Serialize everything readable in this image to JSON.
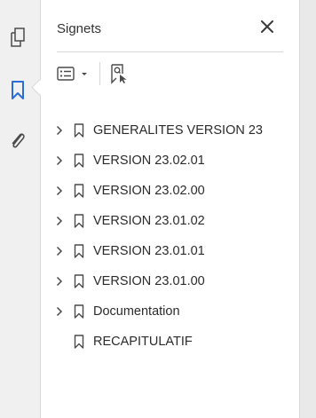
{
  "colors": {
    "accent": "#2b6cd6",
    "icon": "#4a4a4a",
    "panel_bg": "#ffffff",
    "rail_bg": "#f0f0f0"
  },
  "rail": {
    "items": [
      {
        "icon": "page-thumbnails-icon",
        "selected": false
      },
      {
        "icon": "bookmark-icon",
        "selected": true
      },
      {
        "icon": "attachment-icon",
        "selected": false
      }
    ]
  },
  "panel": {
    "title": "Signets",
    "close_icon": "close-icon",
    "toolbar": {
      "options_icon": "options-list-icon",
      "dropdown_icon": "caret-down-icon",
      "find_icon": "find-current-bookmark-icon"
    }
  },
  "bookmarks": [
    {
      "label": "GENERALITES VERSION 23",
      "expandable": true
    },
    {
      "label": "VERSION 23.02.01",
      "expandable": true
    },
    {
      "label": "VERSION 23.02.00",
      "expandable": true
    },
    {
      "label": "VERSION 23.01.02",
      "expandable": true
    },
    {
      "label": "VERSION 23.01.01",
      "expandable": true
    },
    {
      "label": "VERSION 23.01.00",
      "expandable": true
    },
    {
      "label": "Documentation",
      "expandable": true
    },
    {
      "label": "RECAPITULATIF",
      "expandable": false
    }
  ]
}
